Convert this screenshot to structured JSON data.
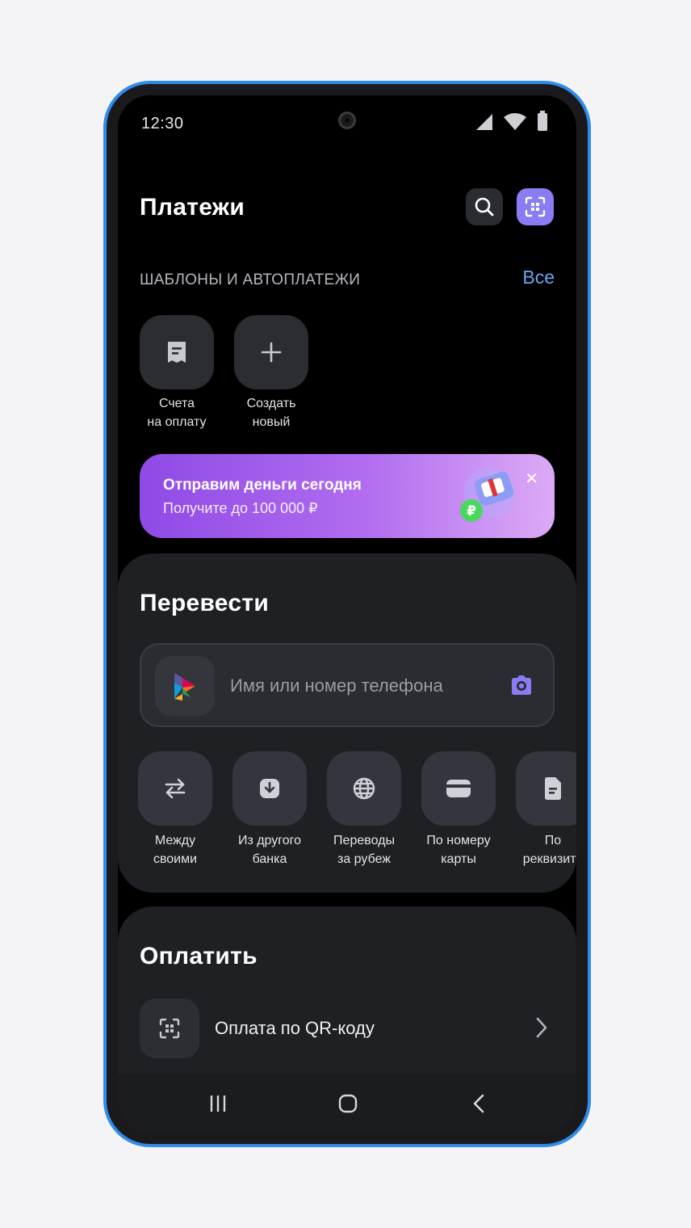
{
  "status_bar": {
    "time": "12:30",
    "icons": [
      "signal-icon",
      "wifi-icon",
      "battery-icon"
    ]
  },
  "header": {
    "title": "Платежи",
    "search_icon": "search-icon",
    "qr_icon": "qr-scan-icon"
  },
  "templates": {
    "label": "ШАБЛОНЫ И АВТОПЛАТЕЖИ",
    "all_link": "Все",
    "items": [
      {
        "line1": "Счета",
        "line2": "на оплату",
        "icon": "receipt-icon"
      },
      {
        "line1": "Создать",
        "line2": "новый",
        "icon": "plus-icon"
      }
    ]
  },
  "banner": {
    "title": "Отправим деньги сегодня",
    "subtitle": "Получите до 100 000 ₽",
    "close_icon": "close-icon"
  },
  "transfer": {
    "title": "Перевести",
    "search_placeholder": "Имя или номер телефона",
    "quick_actions": [
      {
        "line1": "Между",
        "line2": "своими",
        "icon": "swap-arrows-icon"
      },
      {
        "line1": "Из другого",
        "line2": "банка",
        "icon": "download-icon"
      },
      {
        "line1": "Переводы",
        "line2": "за рубеж",
        "icon": "globe-icon"
      },
      {
        "line1": "По номеру",
        "line2": "карты",
        "icon": "card-icon"
      },
      {
        "line1": "По",
        "line2": "реквизита",
        "icon": "document-icon"
      }
    ]
  },
  "pay": {
    "title": "Оплатить",
    "items": [
      {
        "label": "Оплата по QR-коду",
        "icon": "qr-scan-icon"
      }
    ]
  },
  "colors": {
    "accent": "#8a7cf2",
    "link": "#6aa6f2",
    "frame": "#2f8ce8",
    "banner_start": "#8f4ae6",
    "banner_end": "#dcaaf6"
  }
}
